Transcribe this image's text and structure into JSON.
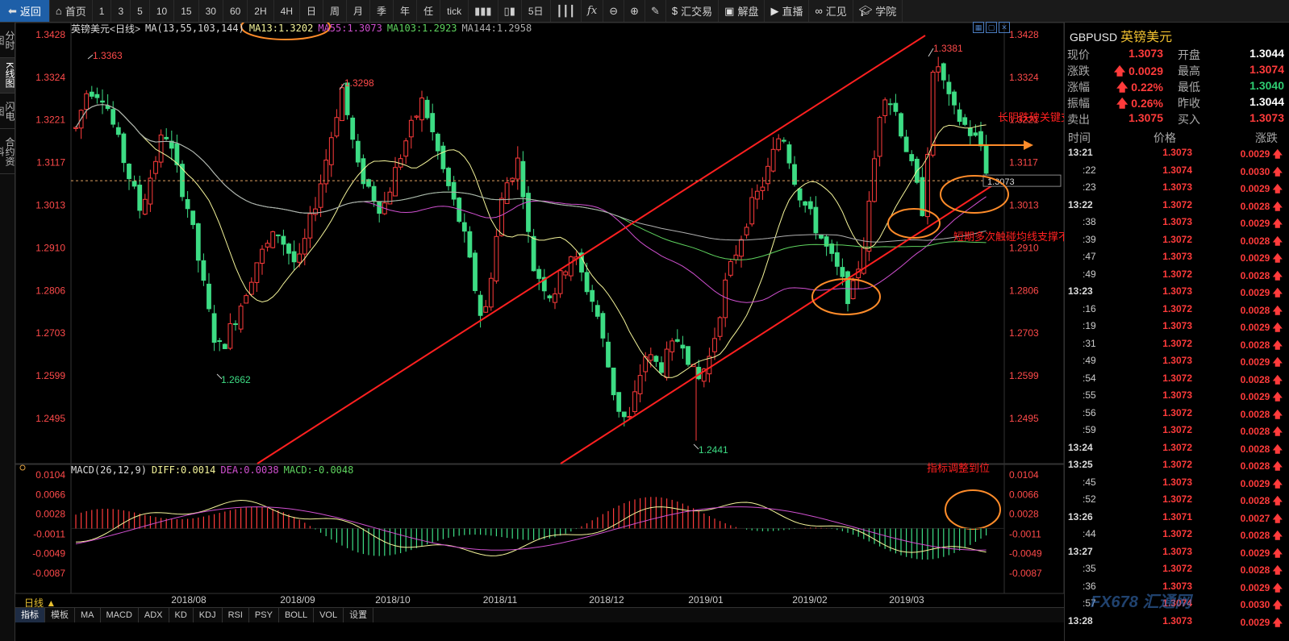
{
  "toolbar": {
    "back": "返回",
    "home": "首页",
    "periods": [
      "1",
      "3",
      "5",
      "10",
      "15",
      "30",
      "60",
      "2H",
      "4H",
      "日",
      "周",
      "月",
      "季",
      "年",
      "任",
      "tick"
    ],
    "five_day": "5日",
    "fx": "fx",
    "huijiaoyi": "汇交易",
    "jiepan": "解盘",
    "zhibo": "直播",
    "huijian": "汇见",
    "xueyuan": "学院"
  },
  "left_tabs": [
    "分时图",
    "K线图",
    "闪电图",
    "合约资料"
  ],
  "chart_header": {
    "symbol": "英镑美元<日线>",
    "ma_params": "MA(13,55,103,144)",
    "ma13": "MA13:1.3202",
    "ma55": "MA55:1.3073",
    "ma103": "MA103:1.2923",
    "ma144": "MA144:1.2958"
  },
  "macd_header": {
    "params": "MACD(26,12,9)",
    "diff": "DIFF:0.0014",
    "dea": "DEA:0.0038",
    "macd": "MACD:-0.0048"
  },
  "colors": {
    "up": "#ff3b3b",
    "down": "#3ddc84",
    "ma13": "#f5f59a",
    "ma55": "#d050d0",
    "ma103": "#5fd45f",
    "ma144": "#b0b0b0",
    "annotation": "#ff2020",
    "ellipse": "#ff8c2a"
  },
  "price_axis": [
    "1.3428",
    "1.3324",
    "1.3221",
    "1.3117",
    "1.3013",
    "1.2910",
    "1.2806",
    "1.2703",
    "1.2599",
    "1.2495"
  ],
  "macd_axis": [
    "0.0104",
    "0.0066",
    "0.0028",
    "-0.0011",
    "-0.0049",
    "-0.0087"
  ],
  "date_axis": [
    "2018/08",
    "2018/09",
    "2018/10",
    "2018/11",
    "2018/12",
    "2019/01",
    "2019/02",
    "2019/03"
  ],
  "price_labels": {
    "hi1": "1.3363",
    "hi2": "1.3298",
    "lo1": "1.2662",
    "lo2": "1.2441",
    "hi3": "1.3381",
    "current": "1.3073"
  },
  "annotations": {
    "a1": "长阴跌破关键支撑且收在低点",
    "a2": "短期多次触碰均线支撑不太妙",
    "a3": "指标调整到位"
  },
  "bottom": {
    "period": "日线 ▲",
    "tabs": [
      "指标",
      "模板",
      "MA",
      "MACD",
      "ADX",
      "KD",
      "KDJ",
      "RSI",
      "PSY",
      "BOLL",
      "VOL",
      "设置"
    ]
  },
  "quote": {
    "symbol": "GBPUSD",
    "name": "英镑美元",
    "labels": {
      "now": "现价",
      "change": "涨跌",
      "pct": "涨幅",
      "amp": "振幅",
      "sell": "卖出",
      "open": "开盘",
      "high": "最高",
      "low": "最低",
      "prev": "昨收",
      "buy": "买入"
    },
    "now": "1.3073",
    "change": "0.0029",
    "pct": "0.22%",
    "amp": "0.26%",
    "sell": "1.3075",
    "open": "1.3044",
    "high": "1.3074",
    "low": "1.3040",
    "prev": "1.3044",
    "buy": "1.3073"
  },
  "tick_header": {
    "time": "时间",
    "price": "价格",
    "change": "涨跌"
  },
  "ticks": [
    {
      "t": "13:21",
      "p": "1.3073",
      "c": "0.0029"
    },
    {
      "t": ":22",
      "p": "1.3074",
      "c": "0.0030"
    },
    {
      "t": ":23",
      "p": "1.3073",
      "c": "0.0029"
    },
    {
      "t": "13:22",
      "p": "1.3072",
      "c": "0.0028"
    },
    {
      "t": ":38",
      "p": "1.3073",
      "c": "0.0029"
    },
    {
      "t": ":39",
      "p": "1.3072",
      "c": "0.0028"
    },
    {
      "t": ":47",
      "p": "1.3073",
      "c": "0.0029"
    },
    {
      "t": ":49",
      "p": "1.3072",
      "c": "0.0028"
    },
    {
      "t": "13:23",
      "p": "1.3073",
      "c": "0.0029"
    },
    {
      "t": ":16",
      "p": "1.3072",
      "c": "0.0028"
    },
    {
      "t": ":19",
      "p": "1.3073",
      "c": "0.0029"
    },
    {
      "t": ":31",
      "p": "1.3072",
      "c": "0.0028"
    },
    {
      "t": ":49",
      "p": "1.3073",
      "c": "0.0029"
    },
    {
      "t": ":54",
      "p": "1.3072",
      "c": "0.0028"
    },
    {
      "t": ":55",
      "p": "1.3073",
      "c": "0.0029"
    },
    {
      "t": ":56",
      "p": "1.3072",
      "c": "0.0028"
    },
    {
      "t": ":59",
      "p": "1.3072",
      "c": "0.0028"
    },
    {
      "t": "13:24",
      "p": "1.3072",
      "c": "0.0028"
    },
    {
      "t": "13:25",
      "p": "1.3072",
      "c": "0.0028"
    },
    {
      "t": ":45",
      "p": "1.3073",
      "c": "0.0029"
    },
    {
      "t": ":52",
      "p": "1.3072",
      "c": "0.0028"
    },
    {
      "t": "13:26",
      "p": "1.3071",
      "c": "0.0027"
    },
    {
      "t": ":44",
      "p": "1.3072",
      "c": "0.0028"
    },
    {
      "t": "13:27",
      "p": "1.3073",
      "c": "0.0029"
    },
    {
      "t": ":35",
      "p": "1.3072",
      "c": "0.0028"
    },
    {
      "t": ":36",
      "p": "1.3073",
      "c": "0.0029"
    },
    {
      "t": ":57",
      "p": "1.3074",
      "c": "0.0030"
    },
    {
      "t": "13:28",
      "p": "1.3073",
      "c": "0.0029"
    }
  ],
  "watermark": "FX678 汇通网"
}
